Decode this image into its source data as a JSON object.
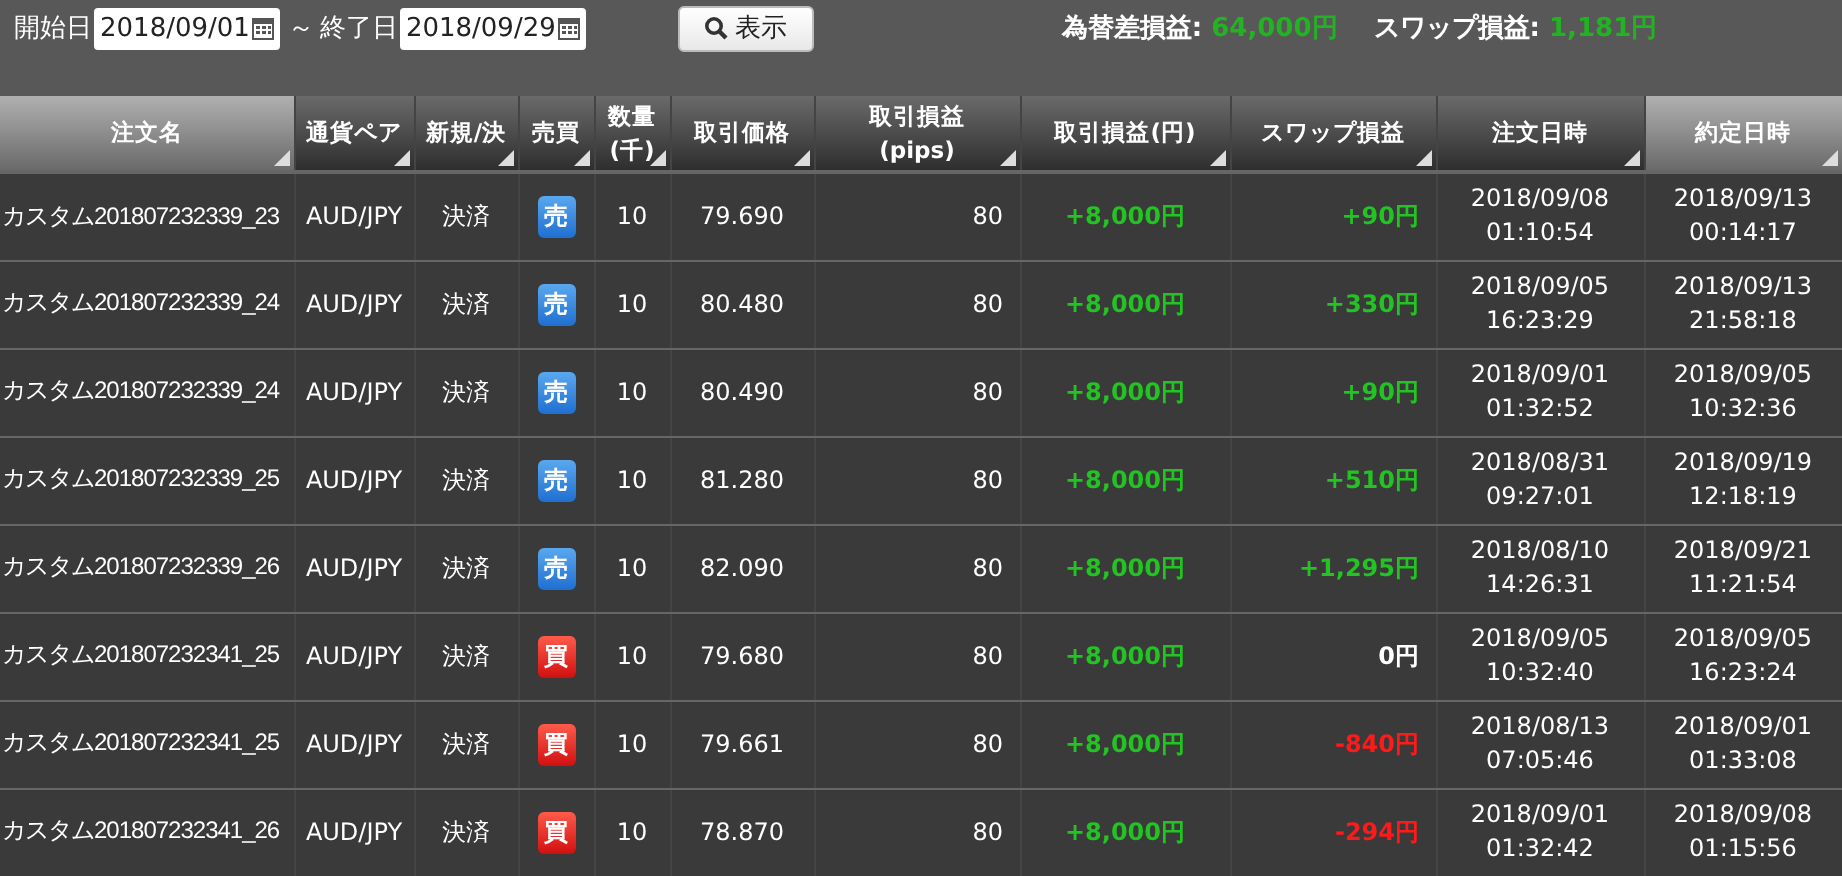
{
  "filter": {
    "start_label": "開始日",
    "start_date": "2018/09/01",
    "separator": "～",
    "end_label": "終了日",
    "end_date": "2018/09/29",
    "show_button": "表示"
  },
  "summary": [
    {
      "label": "為替差損益:",
      "value": "64,000円"
    },
    {
      "label": "スワップ損益:",
      "value": "1,181円"
    }
  ],
  "table": {
    "columns": [
      {
        "lines": [
          "注文名"
        ],
        "sorted": true
      },
      {
        "lines": [
          "通貨ペア"
        ],
        "sorted": false
      },
      {
        "lines": [
          "新規/決"
        ],
        "sorted": false
      },
      {
        "lines": [
          "売買"
        ],
        "sorted": false
      },
      {
        "lines": [
          "数量",
          "(千)"
        ],
        "sorted": false
      },
      {
        "lines": [
          "取引価格"
        ],
        "sorted": false
      },
      {
        "lines": [
          "取引損益",
          "(pips)"
        ],
        "sorted": false
      },
      {
        "lines": [
          "取引損益(円)"
        ],
        "sorted": false
      },
      {
        "lines": [
          "スワップ損益"
        ],
        "sorted": false
      },
      {
        "lines": [
          "注文日時"
        ],
        "sorted": false
      },
      {
        "lines": [
          "約定日時"
        ],
        "sorted": true
      }
    ],
    "rows": [
      {
        "name": "カスタム201807232339_23",
        "pair": "AUD/JPY",
        "type": "決済",
        "side": {
          "kind": "sell",
          "label": "売"
        },
        "qty": "10",
        "price": "79.690",
        "pips": "80",
        "pl": {
          "text": "+8,000円",
          "kind": "gain"
        },
        "swap": {
          "text": "+90円",
          "kind": "gain"
        },
        "order_time": [
          "2018/09/08",
          "01:10:54"
        ],
        "exec_time": [
          "2018/09/13",
          "00:14:17"
        ]
      },
      {
        "name": "カスタム201807232339_24",
        "pair": "AUD/JPY",
        "type": "決済",
        "side": {
          "kind": "sell",
          "label": "売"
        },
        "qty": "10",
        "price": "80.480",
        "pips": "80",
        "pl": {
          "text": "+8,000円",
          "kind": "gain"
        },
        "swap": {
          "text": "+330円",
          "kind": "gain"
        },
        "order_time": [
          "2018/09/05",
          "16:23:29"
        ],
        "exec_time": [
          "2018/09/13",
          "21:58:18"
        ]
      },
      {
        "name": "カスタム201807232339_24",
        "pair": "AUD/JPY",
        "type": "決済",
        "side": {
          "kind": "sell",
          "label": "売"
        },
        "qty": "10",
        "price": "80.490",
        "pips": "80",
        "pl": {
          "text": "+8,000円",
          "kind": "gain"
        },
        "swap": {
          "text": "+90円",
          "kind": "gain"
        },
        "order_time": [
          "2018/09/01",
          "01:32:52"
        ],
        "exec_time": [
          "2018/09/05",
          "10:32:36"
        ]
      },
      {
        "name": "カスタム201807232339_25",
        "pair": "AUD/JPY",
        "type": "決済",
        "side": {
          "kind": "sell",
          "label": "売"
        },
        "qty": "10",
        "price": "81.280",
        "pips": "80",
        "pl": {
          "text": "+8,000円",
          "kind": "gain"
        },
        "swap": {
          "text": "+510円",
          "kind": "gain"
        },
        "order_time": [
          "2018/08/31",
          "09:27:01"
        ],
        "exec_time": [
          "2018/09/19",
          "12:18:19"
        ]
      },
      {
        "name": "カスタム201807232339_26",
        "pair": "AUD/JPY",
        "type": "決済",
        "side": {
          "kind": "sell",
          "label": "売"
        },
        "qty": "10",
        "price": "82.090",
        "pips": "80",
        "pl": {
          "text": "+8,000円",
          "kind": "gain"
        },
        "swap": {
          "text": "+1,295円",
          "kind": "gain"
        },
        "order_time": [
          "2018/08/10",
          "14:26:31"
        ],
        "exec_time": [
          "2018/09/21",
          "11:21:54"
        ]
      },
      {
        "name": "カスタム201807232341_25",
        "pair": "AUD/JPY",
        "type": "決済",
        "side": {
          "kind": "buy",
          "label": "買"
        },
        "qty": "10",
        "price": "79.680",
        "pips": "80",
        "pl": {
          "text": "+8,000円",
          "kind": "gain"
        },
        "swap": {
          "text": "0円",
          "kind": "neutral"
        },
        "order_time": [
          "2018/09/05",
          "10:32:40"
        ],
        "exec_time": [
          "2018/09/05",
          "16:23:24"
        ]
      },
      {
        "name": "カスタム201807232341_25",
        "pair": "AUD/JPY",
        "type": "決済",
        "side": {
          "kind": "buy",
          "label": "買"
        },
        "qty": "10",
        "price": "79.661",
        "pips": "80",
        "pl": {
          "text": "+8,000円",
          "kind": "gain"
        },
        "swap": {
          "text": "-840円",
          "kind": "loss"
        },
        "order_time": [
          "2018/08/13",
          "07:05:46"
        ],
        "exec_time": [
          "2018/09/01",
          "01:33:08"
        ]
      },
      {
        "name": "カスタム201807232341_26",
        "pair": "AUD/JPY",
        "type": "決済",
        "side": {
          "kind": "buy",
          "label": "買"
        },
        "qty": "10",
        "price": "78.870",
        "pips": "80",
        "pl": {
          "text": "+8,000円",
          "kind": "gain"
        },
        "swap": {
          "text": "-294円",
          "kind": "loss"
        },
        "order_time": [
          "2018/09/01",
          "01:32:42"
        ],
        "exec_time": [
          "2018/09/08",
          "01:15:56"
        ]
      }
    ]
  }
}
